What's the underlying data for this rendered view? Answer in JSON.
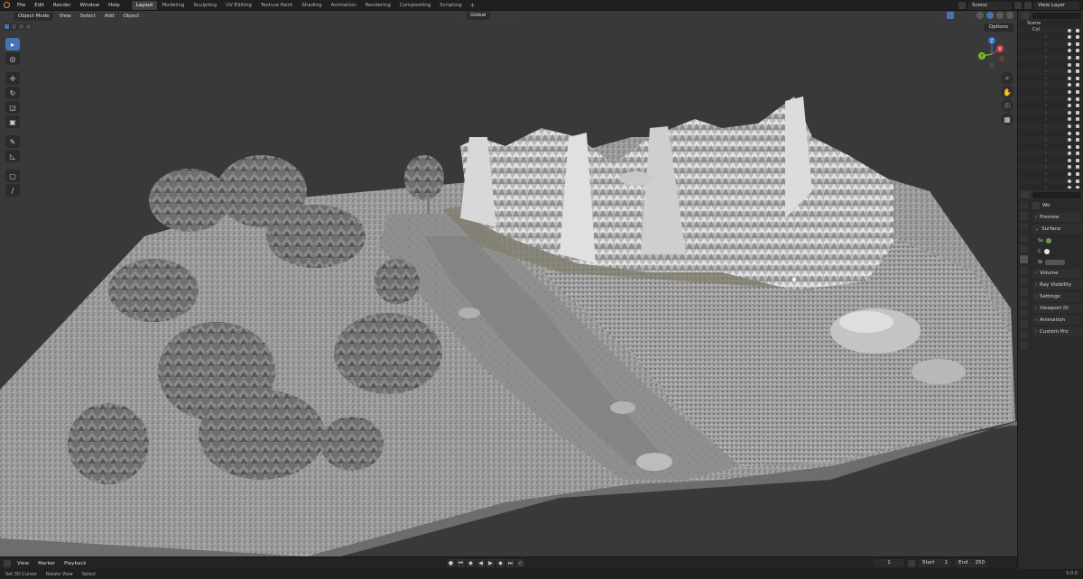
{
  "topbar": {
    "menus": [
      "File",
      "Edit",
      "Render",
      "Window",
      "Help"
    ],
    "workspaces": [
      "Layout",
      "Modeling",
      "Sculpting",
      "UV Editing",
      "Texture Paint",
      "Shading",
      "Animation",
      "Rendering",
      "Compositing",
      "Scripting"
    ],
    "active_workspace": "Layout",
    "scene_name": "Scene",
    "view_layer": "View Layer"
  },
  "viewport": {
    "mode": "Object Mode",
    "menus": [
      "View",
      "Select",
      "Add",
      "Object"
    ],
    "transform_orientation": "Global",
    "options_label": "Options",
    "gizmo_axes": {
      "x": "X",
      "y": "Y",
      "z": "Z"
    }
  },
  "toolbar": {
    "tools": [
      "select-box-icon",
      "cursor-icon",
      "move-icon",
      "rotate-icon",
      "scale-icon",
      "transform-icon",
      "annotate-icon",
      "measure-icon",
      "add-cube-icon",
      "knife-icon"
    ]
  },
  "timeline": {
    "menus": [
      "View",
      "Marker",
      "Playback"
    ],
    "current_frame": "1",
    "start_label": "Start",
    "start_value": "1",
    "end_label": "End",
    "end_value": "250"
  },
  "statusbar": {
    "hints": [
      "Set 3D Cursor",
      "Rotate View",
      "Select"
    ],
    "version": "5.0.0"
  },
  "outliner": {
    "rows": [
      "Scene",
      "Col",
      "",
      "",
      "",
      "",
      "",
      "",
      "",
      "",
      "",
      "",
      "",
      "",
      "",
      "",
      "",
      "",
      "",
      "",
      "",
      "",
      "",
      "",
      ""
    ]
  },
  "properties": {
    "world_name": "Wo",
    "surface_field": "Su",
    "color_label": "C",
    "strength_label": "St",
    "panels": [
      "Preview",
      "Surface",
      "Volume",
      "Ray Visibility",
      "Settings",
      "Viewport Di",
      "Animation",
      "Custom Pro"
    ]
  },
  "colors": {
    "accent": "#4772b3",
    "logo": "#e88632",
    "viewport_bg": "#393939"
  }
}
